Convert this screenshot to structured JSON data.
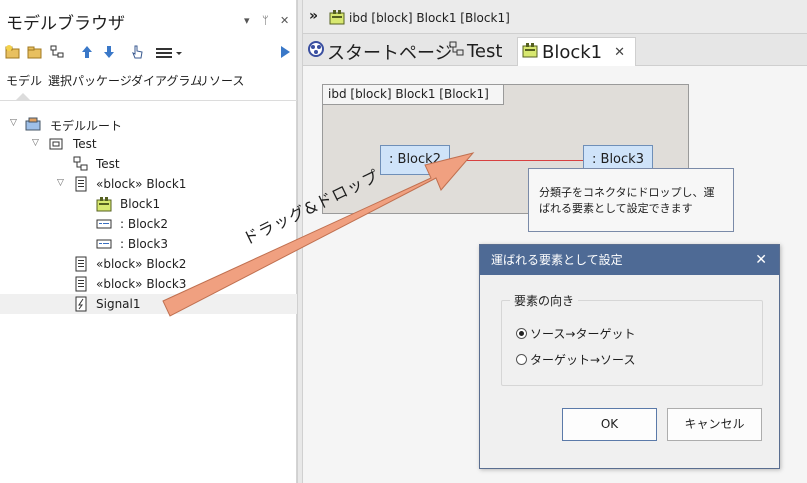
{
  "left_panel": {
    "title": "モデルブラウザ",
    "controls": {
      "dropdown": "▾",
      "pin": "ᛘ",
      "close": "✕"
    },
    "tabs": [
      "モデル",
      "選択パッケージ",
      "ダイアグラム",
      "リソース"
    ],
    "tree": [
      {
        "label": "モデルルート",
        "icon": "model-root-icon",
        "expanded": true
      },
      {
        "label": "Test",
        "icon": "package-icon",
        "expanded": true
      },
      {
        "label": "Test",
        "icon": "diagram-icon"
      },
      {
        "label": "«block» Block1",
        "icon": "block-icon",
        "expanded": true
      },
      {
        "label": "Block1",
        "icon": "ibd-diagram-icon"
      },
      {
        "label": ": Block2",
        "icon": "part-icon"
      },
      {
        "label": ": Block3",
        "icon": "part-icon"
      },
      {
        "label": "«block» Block2",
        "icon": "block-icon"
      },
      {
        "label": "«block» Block3",
        "icon": "block-icon"
      },
      {
        "label": "Signal1",
        "icon": "signal-icon",
        "selected": true
      }
    ]
  },
  "document": {
    "path": "ibd [block] Block1 [Block1]",
    "tabs": [
      {
        "label": "スタートページ",
        "icon": "start-page-icon"
      },
      {
        "label": "Test",
        "icon": "diagram-icon"
      },
      {
        "label": "Block1",
        "icon": "ibd-diagram-icon",
        "active": true
      }
    ],
    "close_glyph": "✕"
  },
  "diagram": {
    "frame_label": "ibd [block] Block1 [Block1]",
    "parts": [
      ": Block2",
      ": Block3"
    ],
    "connector_color": "#d84040",
    "callout": "分類子をコネクタにドロップし、運ばれる要素として設定できます"
  },
  "drag_annotation": "ドラッグ&ドロップ",
  "dialog": {
    "title": "運ばれる要素として設定",
    "group_label": "要素の向き",
    "options": [
      {
        "label": "ソース→ターゲット",
        "selected": true
      },
      {
        "label": "ターゲット→ソース",
        "selected": false
      }
    ],
    "ok_label": "OK",
    "cancel_label": "キャンセル",
    "close_glyph": "✕"
  },
  "colors": {
    "accent": "#4e6a95",
    "part_fill": "#cfe3f9",
    "frame_fill": "#e0ddd9",
    "arrow_fill": "#f0a080"
  }
}
